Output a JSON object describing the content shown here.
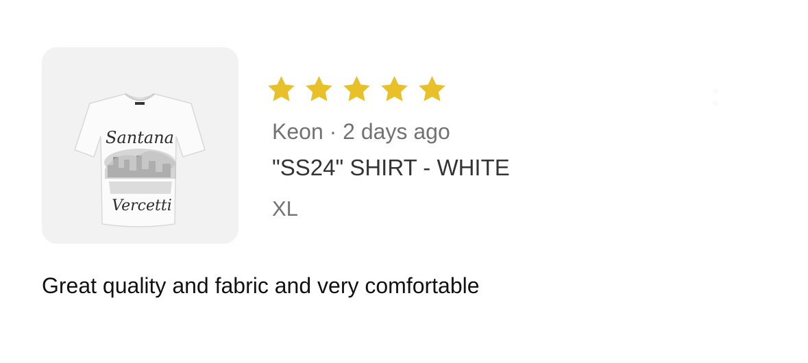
{
  "review": {
    "rating": 5,
    "rating_max": 5,
    "star_color": "#E8C02A",
    "author": "Keon",
    "separator": "·",
    "time_ago": "2 days ago",
    "meta": "Keon · 2 days ago",
    "product_name": "\"SS24\" SHIRT - WHITE",
    "variant": "XL",
    "body": "Great quality and fabric and very comfortable"
  },
  "product_image": {
    "icon": "white-tshirt-product-photo",
    "print_top": "Santana",
    "print_bottom": "Vercetti"
  }
}
